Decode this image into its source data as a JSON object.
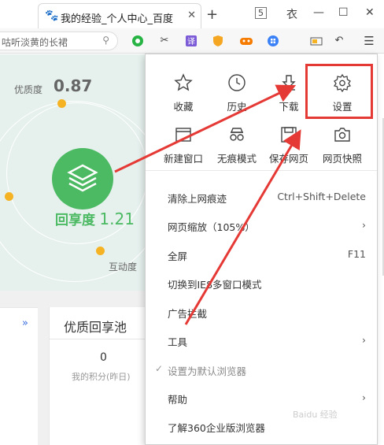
{
  "tab": {
    "title": "我的经验_个人中心_百度",
    "close": "✕"
  },
  "new_tab": "+",
  "window_controls": {
    "profile": "5",
    "skin": "衣",
    "minimize": "—",
    "maximize": "☐",
    "close": "✕"
  },
  "toolbar": {
    "address_text": "咕听淡黄的长裙",
    "search_icon": "search-icon",
    "icons": [
      "wechat-icon",
      "scissors-icon",
      "translate-icon",
      "shield-icon",
      "gamepad-icon",
      "apps-icon",
      "battery-icon",
      "undo-icon",
      "menu-icon"
    ]
  },
  "background": {
    "quality_label": "优质度",
    "quality_value": "0.87",
    "share_label": "回享度",
    "share_value": "1.21",
    "interaction_label": "互动度",
    "expand": "»",
    "pool_title": "优质回享池",
    "points_value": "0",
    "points_label": "我的积分(昨日)"
  },
  "menu": {
    "quick_actions": [
      {
        "label": "收藏",
        "icon": "star-icon"
      },
      {
        "label": "历史",
        "icon": "clock-icon"
      },
      {
        "label": "下载",
        "icon": "download-icon"
      },
      {
        "label": "设置",
        "icon": "gear-icon"
      },
      {
        "label": "新建窗口",
        "icon": "window-icon"
      },
      {
        "label": "无痕模式",
        "icon": "glasses-icon"
      },
      {
        "label": "保存网页",
        "icon": "save-icon"
      },
      {
        "label": "网页快照",
        "icon": "camera-icon"
      }
    ],
    "items": [
      {
        "label": "清除上网痕迹",
        "right": "Ctrl+Shift+Delete"
      },
      {
        "label": "网页缩放（105%）",
        "right": "›"
      },
      {
        "label": "全屏",
        "right": "F11"
      },
      {
        "label": "切换到IE8多窗口模式",
        "right": ""
      },
      {
        "label": "广告拦截",
        "right": ""
      },
      {
        "label": "工具",
        "right": "›"
      },
      {
        "label": "设置为默认浏览器",
        "right": "",
        "check": "✓"
      },
      {
        "label": "帮助",
        "right": "›"
      },
      {
        "label": "了解360企业版浏览器",
        "right": ""
      }
    ]
  },
  "annotation_color": "#e53935",
  "watermark": "Baidu 经验"
}
